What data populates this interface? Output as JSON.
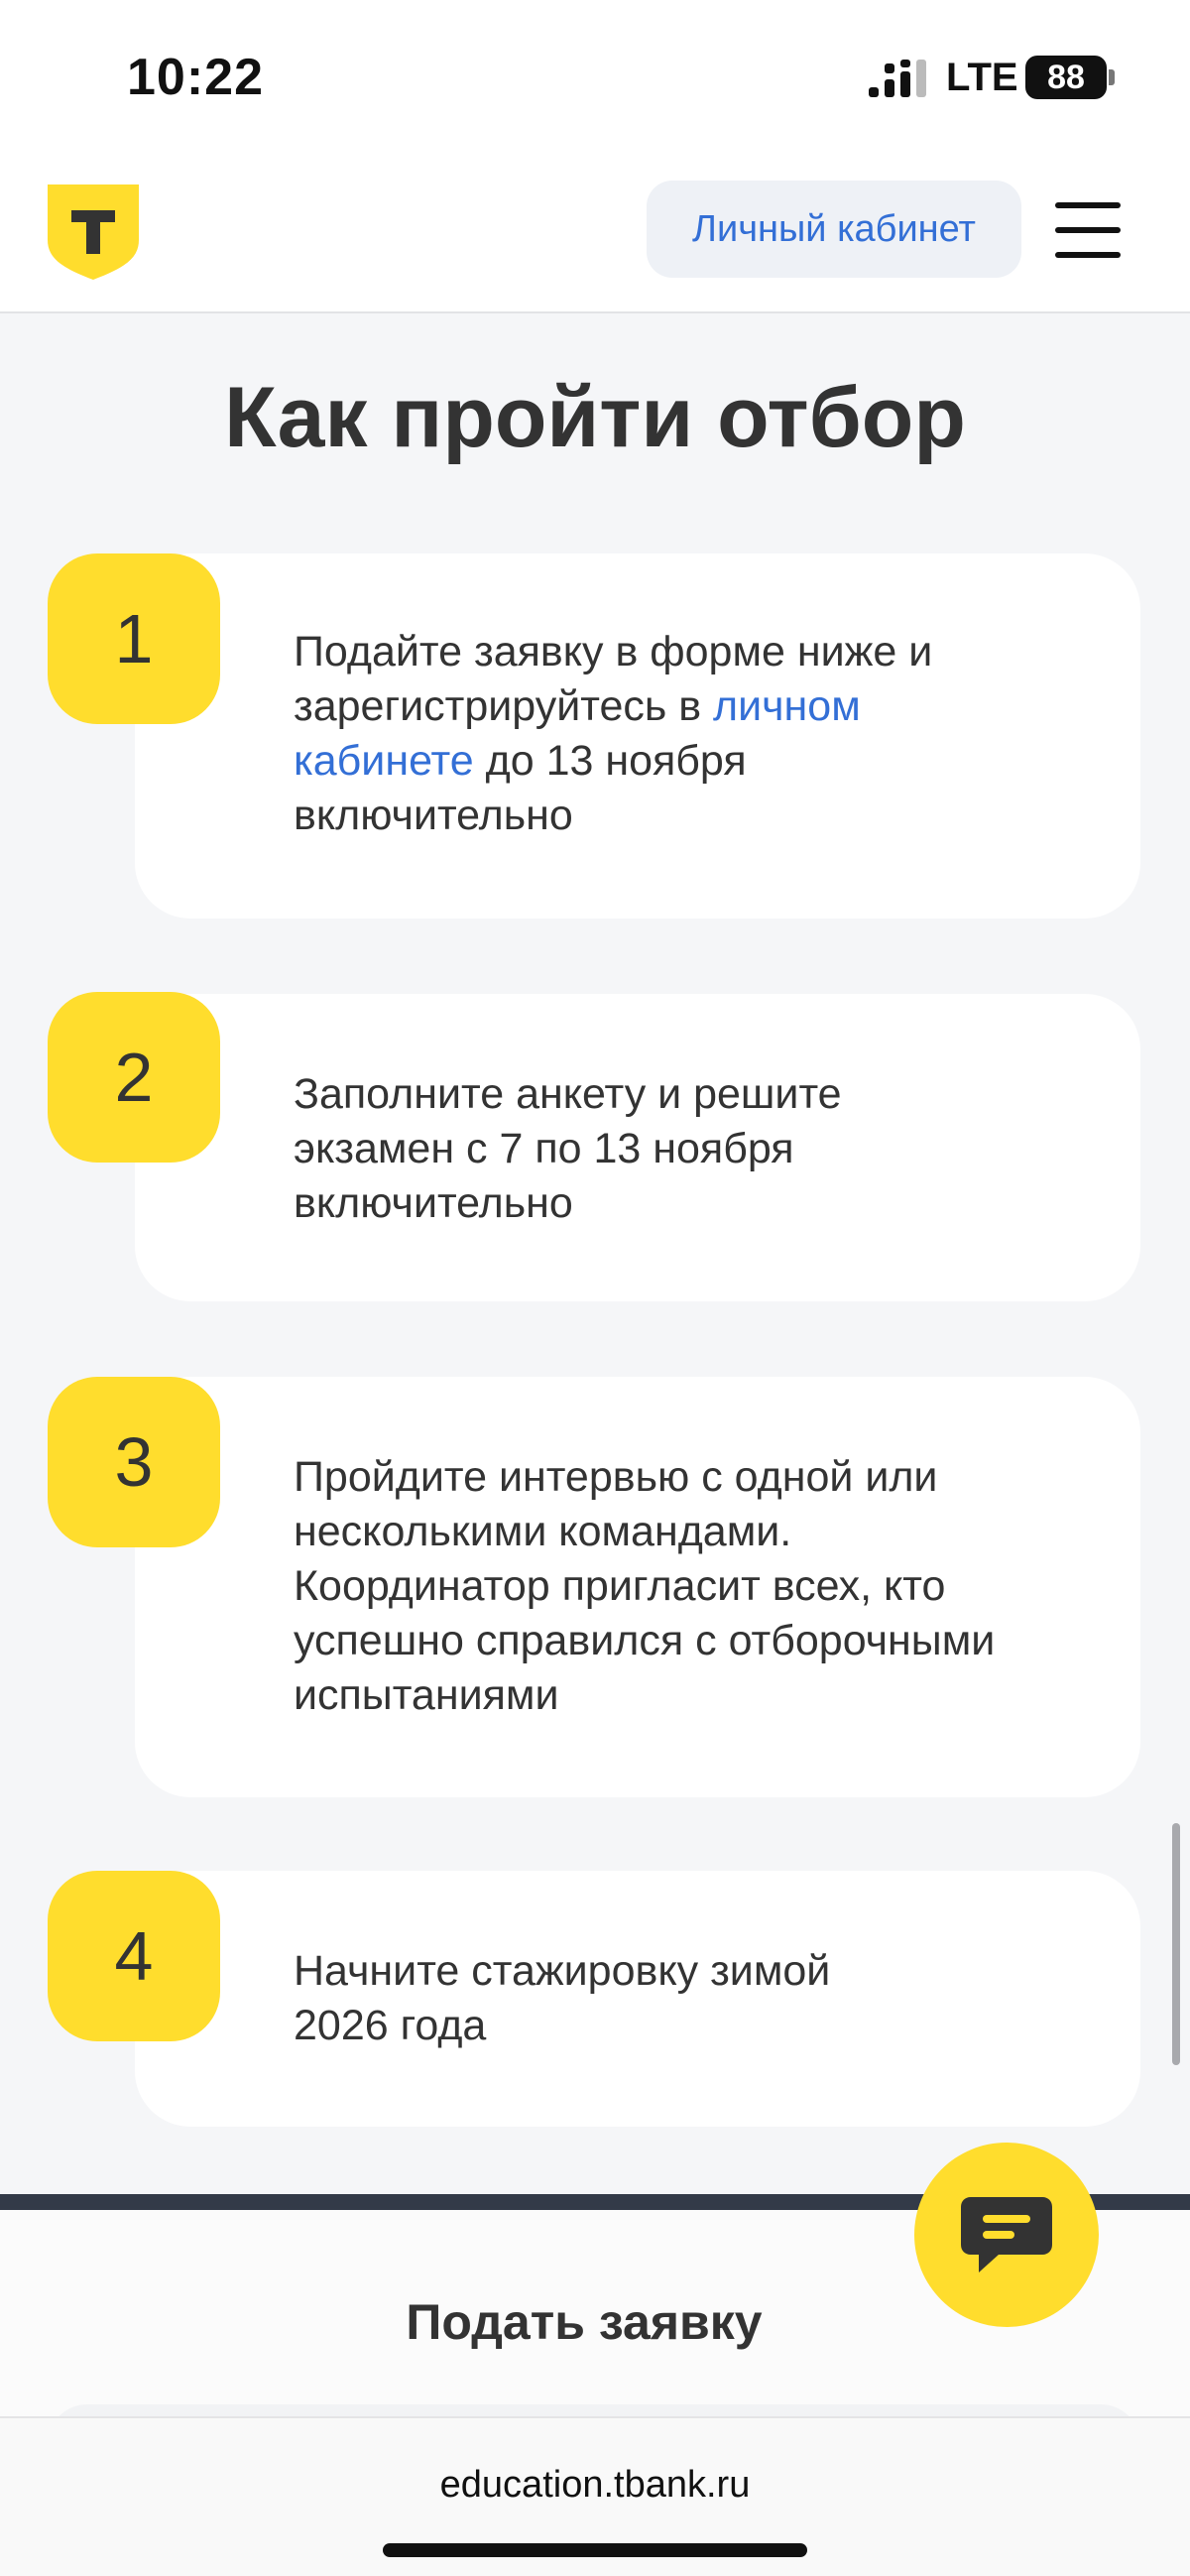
{
  "status_bar": {
    "time": "10:22",
    "network": "LTE",
    "battery": "88"
  },
  "header": {
    "logo_icon": "tbank-shield-logo",
    "logo_letter": "T",
    "cabinet_label": "Личный кабинет",
    "menu_icon": "hamburger-menu-icon"
  },
  "section": {
    "title": "Как пройти отбор"
  },
  "steps": [
    {
      "number": "1",
      "text_before": "Подайте заявку в форме ниже и зарегистрируйтесь в ",
      "link": "личном кабинете",
      "text_after": " до 13 ноября включительно"
    },
    {
      "number": "2",
      "text": "Заполните анкету и решите экзамен с 7 по 13 ноября включительно"
    },
    {
      "number": "3",
      "text": "Пройдите интервью с одной или несколькими командами. Координатор пригласит всех, кто успешно справился с отборочными испытаниями"
    },
    {
      "number": "4",
      "text": "Начните стажировку зимой 2026 года"
    }
  ],
  "apply": {
    "title": "Подать заявку"
  },
  "chat": {
    "icon": "chat-bubble-icon"
  },
  "browser": {
    "url": "education.tbank.ru"
  },
  "colors": {
    "accent_yellow": "#ffdd2d",
    "link_blue": "#336fd6",
    "page_bg": "#f5f6f8",
    "divider_dark": "#333a48"
  }
}
